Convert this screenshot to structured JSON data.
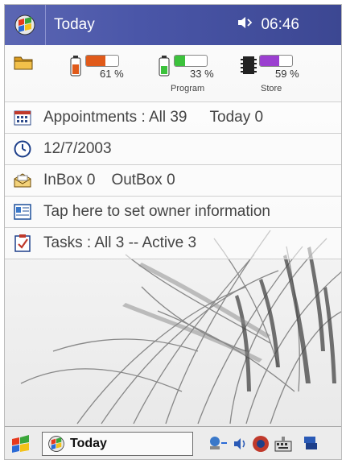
{
  "titlebar": {
    "title": "Today",
    "time": "06:46",
    "start_icon": "start-flag-icon",
    "sound_icon": "speaker-icon"
  },
  "status": {
    "main_battery": {
      "percent_label": "61 %",
      "fill": 0.61,
      "color": "#e05a1a"
    },
    "backup_battery": {
      "percent_label": "33 %",
      "fill": 0.33,
      "color": "#3cc23c",
      "caption": "Program"
    },
    "storage": {
      "percent_label": "59 %",
      "fill": 0.59,
      "color": "#9b3fd0",
      "caption": "Store"
    }
  },
  "items": {
    "appointments": {
      "label": "Appointments : All 39",
      "today": "Today 0"
    },
    "date": {
      "label": "12/7/2003"
    },
    "mail": {
      "inbox": "InBox  0",
      "outbox": "OutBox  0"
    },
    "owner": {
      "label": "Tap here to set owner information"
    },
    "tasks": {
      "label": "Tasks : All 3 -- Active 3"
    }
  },
  "taskbar": {
    "today_label": "Today"
  }
}
